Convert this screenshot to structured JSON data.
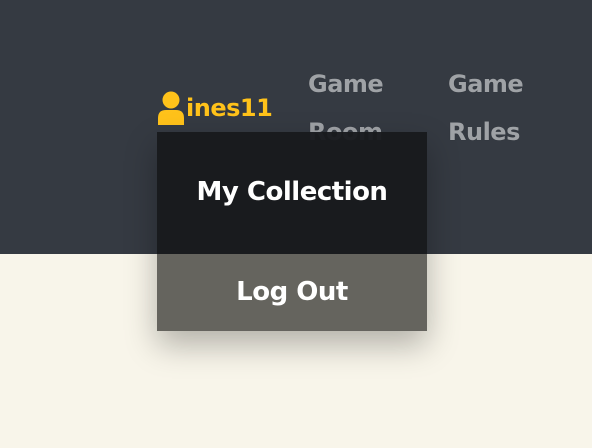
{
  "header": {
    "background": "#353a42",
    "user": {
      "icon": "user-icon",
      "name": "ines11",
      "color": "#ffc21a"
    },
    "nav": [
      {
        "line1": "Game",
        "line2": "Room"
      },
      {
        "line1": "Game",
        "line2": "Rules"
      }
    ]
  },
  "dropdown": {
    "items": [
      {
        "label": "My Collection"
      },
      {
        "label": "Log Out"
      }
    ]
  },
  "page": {
    "background": "#f8f5ea"
  }
}
